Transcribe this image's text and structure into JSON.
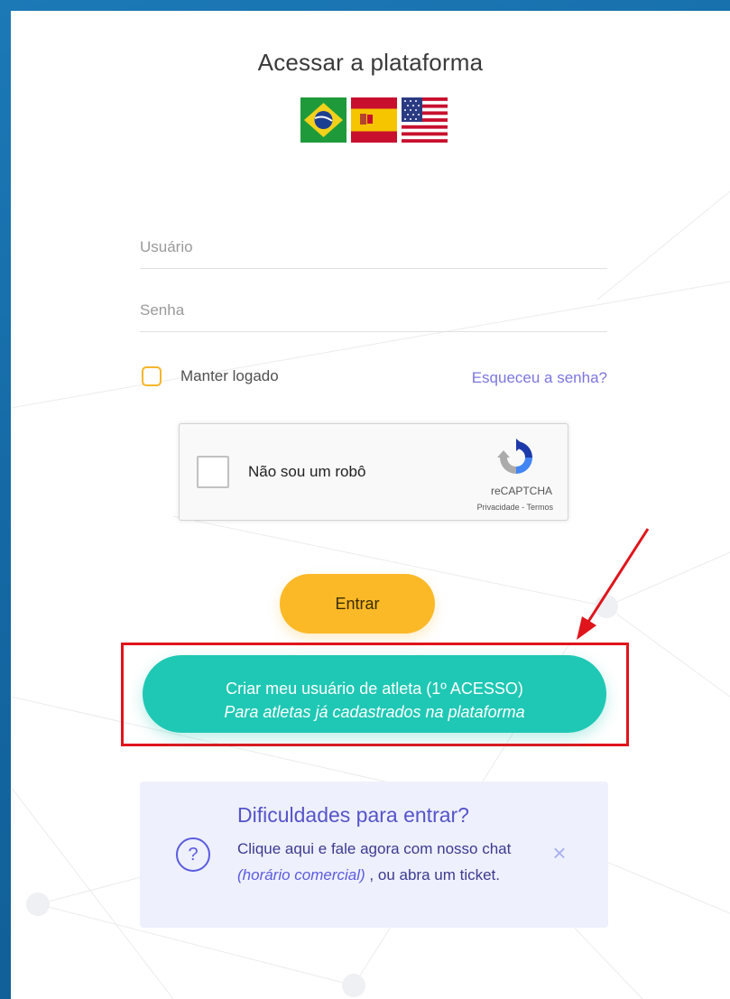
{
  "title": "Acessar a plataforma",
  "languages": [
    {
      "code": "pt-BR",
      "icon": "brazil-flag-icon"
    },
    {
      "code": "es",
      "icon": "spain-flag-icon"
    },
    {
      "code": "en-US",
      "icon": "usa-flag-icon"
    }
  ],
  "form": {
    "username_placeholder": "Usuário",
    "password_placeholder": "Senha",
    "remember_label": "Manter logado",
    "forgot_link": "Esqueceu a senha?"
  },
  "recaptcha": {
    "label": "Não sou um robô",
    "brand": "reCAPTCHA",
    "privacy": "Privacidade",
    "separator": " - ",
    "terms": "Termos"
  },
  "buttons": {
    "enter": "Entrar",
    "create_line1": "Criar meu usuário de atleta (1º ACESSO)",
    "create_line2": "Para atletas já cadastrados na plataforma"
  },
  "help": {
    "title": "Dificuldades para entrar?",
    "text_part1": "Clique aqui e fale agora com nosso chat ",
    "text_hours": "(horário comercial)",
    "text_part2": " , ou abra um ticket.",
    "close_icon": "close-icon",
    "help_icon": "question-circle-icon"
  },
  "colors": {
    "page_background": "#1468a3",
    "accent_yellow": "#fbb927",
    "accent_teal": "#1fc8b4",
    "link_purple": "#7b76e0",
    "annotation_red": "#e0141b"
  }
}
